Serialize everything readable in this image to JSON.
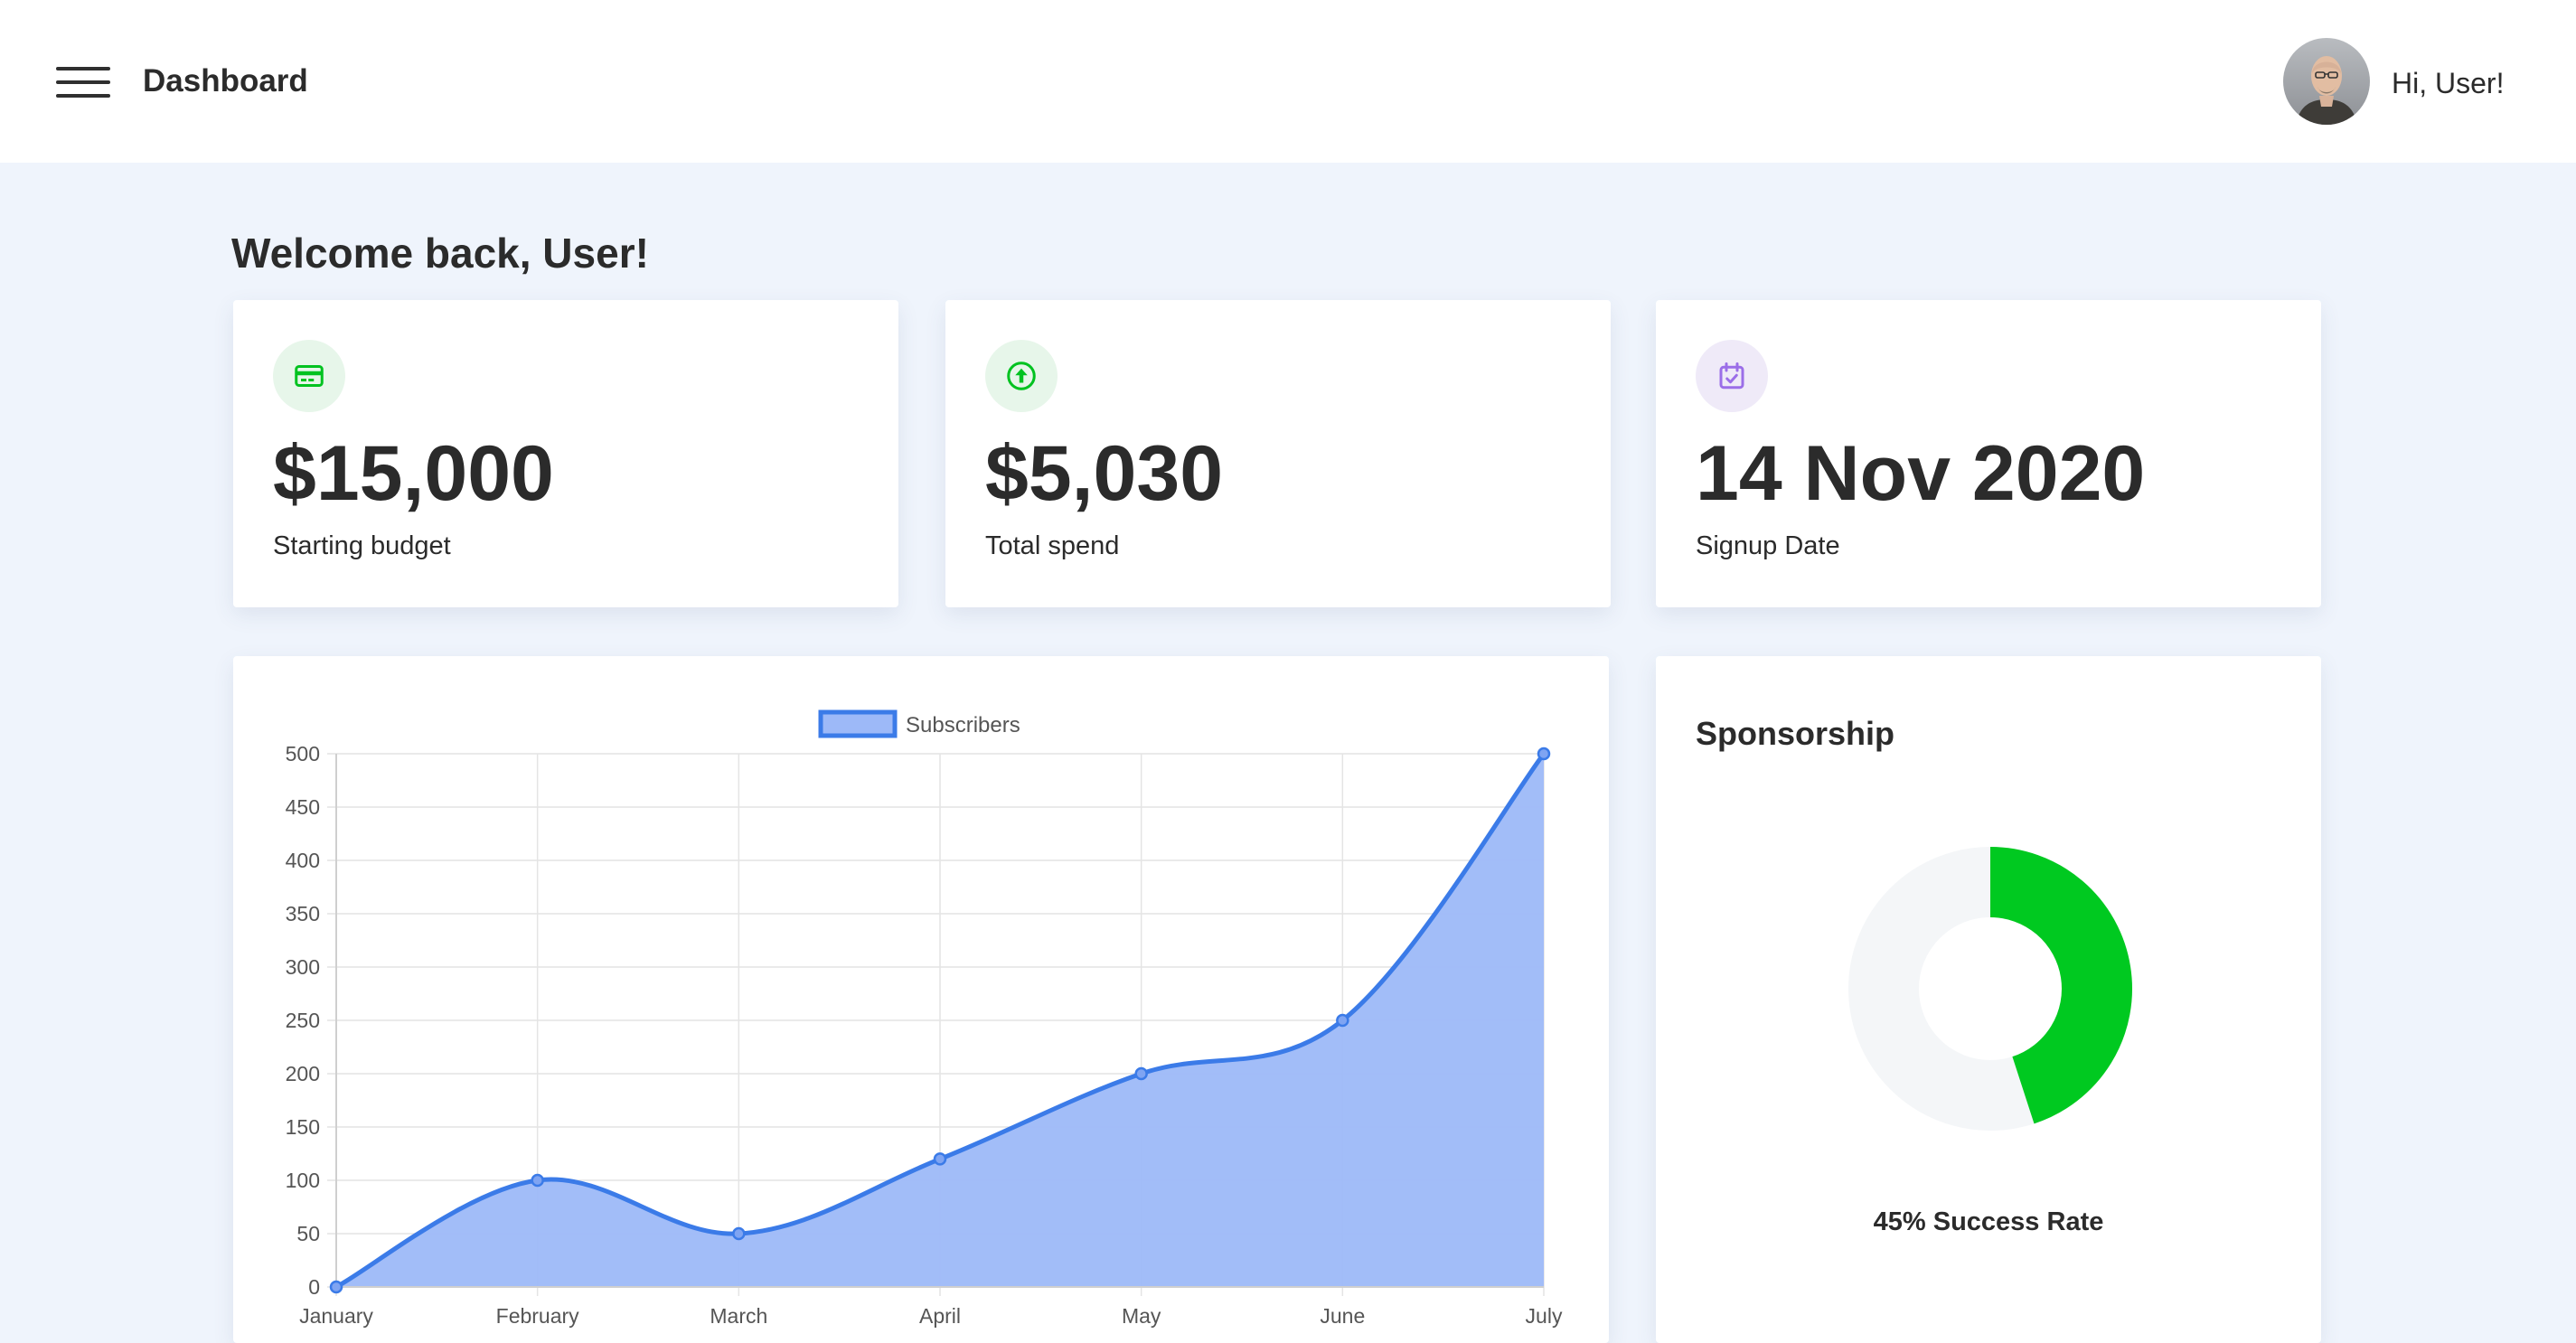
{
  "header": {
    "title": "Dashboard",
    "greeting": "Hi, User!"
  },
  "welcome": "Welcome back, User!",
  "stats": [
    {
      "value": "$15,000",
      "label": "Starting budget",
      "icon": "credit-card-icon",
      "icon_color": "#00c220",
      "icon_bg": "#e7f6ea"
    },
    {
      "value": "$5,030",
      "label": "Total spend",
      "icon": "arrow-up-circle-icon",
      "icon_color": "#00c220",
      "icon_bg": "#e7f6ea"
    },
    {
      "value": "14 Nov 2020",
      "label": "Signup Date",
      "icon": "calendar-check-icon",
      "icon_color": "#9b6ee8",
      "icon_bg": "#efeaf8"
    }
  ],
  "chart_data": {
    "type": "area",
    "x": [
      "January",
      "February",
      "March",
      "April",
      "May",
      "June",
      "July"
    ],
    "series": [
      {
        "name": "Subscribers",
        "values": [
          0,
          100,
          50,
          120,
          200,
          250,
          500
        ]
      }
    ],
    "ylim": [
      0,
      500
    ],
    "yticks": [
      0,
      50,
      100,
      150,
      200,
      250,
      300,
      350,
      400,
      450,
      500
    ],
    "grid": true,
    "legend": "top",
    "line_color": "#3b7be8",
    "fill_color": "#9db9f8"
  },
  "sponsorship": {
    "title": "Sponsorship",
    "success_rate": 0.45,
    "caption": "45% Success Rate",
    "success_color": "#00c920",
    "remainder_color": "#f4f6f8"
  }
}
